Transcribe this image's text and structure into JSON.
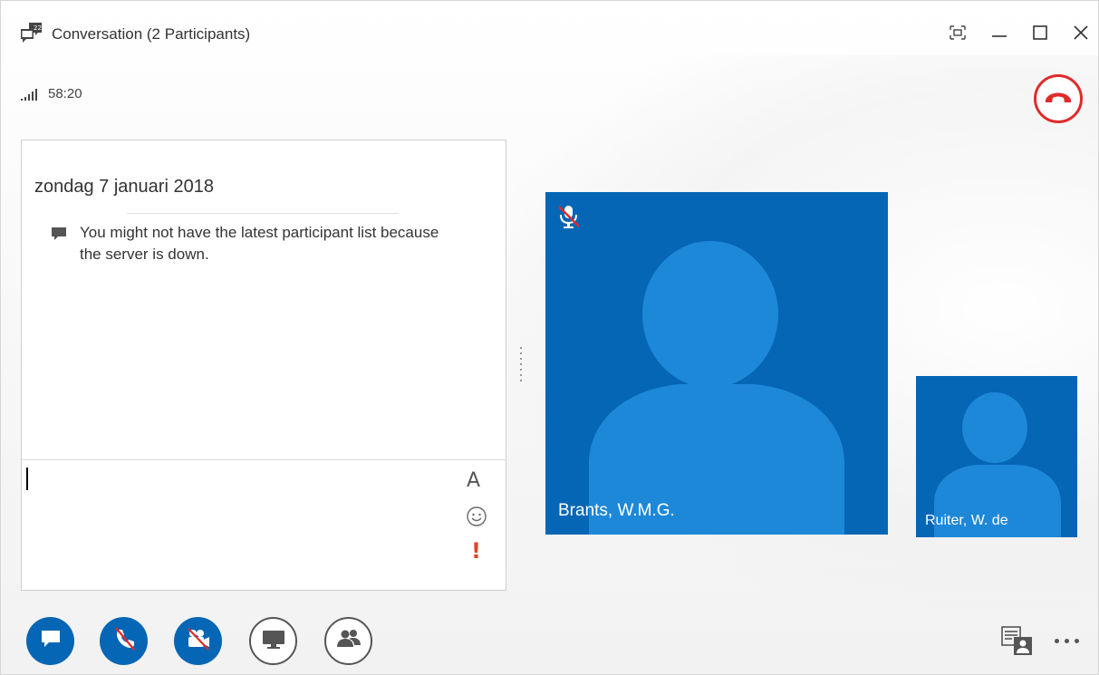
{
  "window": {
    "title": "Conversation (2 Participants)"
  },
  "call": {
    "duration": "58:20"
  },
  "chat": {
    "date": "zondag 7 januari 2018",
    "system_message": "You might not have the latest participant list because the server is down.",
    "format_label": "A",
    "important_label": "!"
  },
  "participants": [
    {
      "name": "Brants, W.M.G.",
      "muted": true
    },
    {
      "name": "Ruiter, W. de",
      "muted": false
    }
  ],
  "colors": {
    "tile_blue": "#0566b5",
    "avatar_blue": "#1e88d8",
    "hangup_red": "#e02b2b",
    "important_orange": "#e0442a"
  },
  "icons": {
    "app": "conversation-icon",
    "compact": "compact-mode-icon",
    "minimize": "minimize-icon",
    "maximize": "maximize-icon",
    "close": "close-icon",
    "signal": "signal-strength-icon",
    "hangup": "hang-up-icon",
    "im": "instant-message-icon",
    "audio": "audio-muted-icon",
    "video": "video-off-icon",
    "present": "present-screen-icon",
    "people": "participants-icon",
    "layout": "layout-view-icon",
    "more": "more-options-icon"
  }
}
